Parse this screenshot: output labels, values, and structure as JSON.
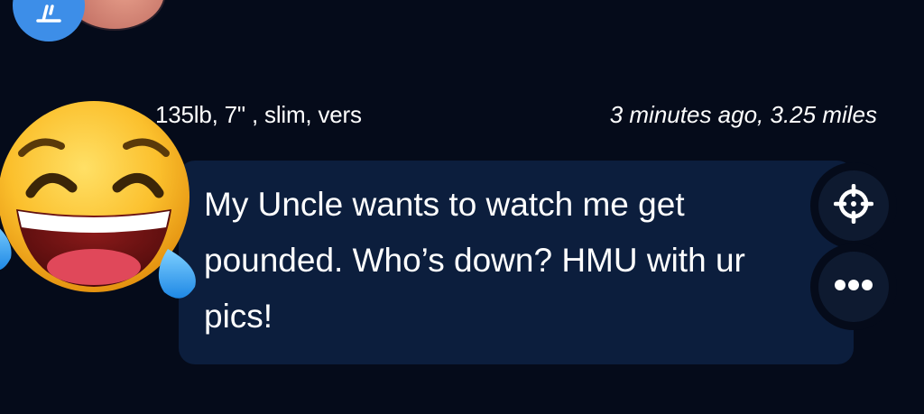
{
  "post": {
    "stats": "135lb, 7\" , slim, vers",
    "time_distance": "3 minutes ago, 3.25 miles",
    "message": "My Uncle wants to watch me get pounded. Who’s down? HMU with ur pics!"
  },
  "icons": {
    "top_badge": "pin-icon",
    "sticker": "face-with-tears-of-joy-emoji",
    "locate": "crosshair-icon",
    "more": "more-dots-icon"
  },
  "colors": {
    "background": "#050b1a",
    "bubble": "#0c1e3d",
    "badge": "#3d8ee8",
    "text": "#ffffff"
  }
}
